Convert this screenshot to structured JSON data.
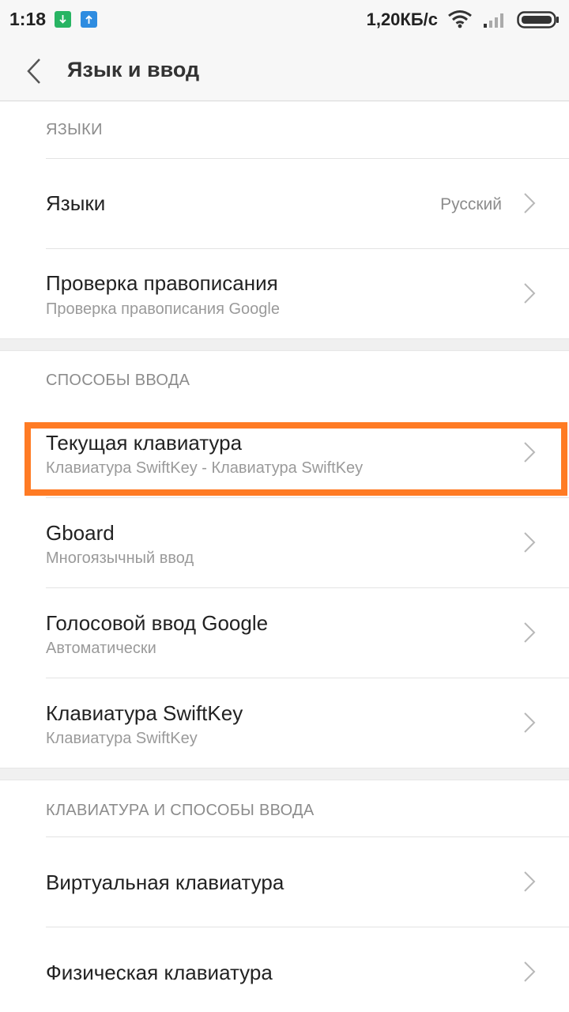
{
  "status_bar": {
    "time": "1:18",
    "speed": "1,20КБ/с",
    "notif_colors": [
      "#28b463",
      "#2e8ce0"
    ]
  },
  "header": {
    "title": "Язык и ввод",
    "back_icon": "chevron-left-icon"
  },
  "sections": [
    {
      "header": "ЯЗЫКИ",
      "items": [
        {
          "title": "Языки",
          "value": "Русский"
        },
        {
          "title": "Проверка правописания",
          "subtitle": "Проверка правописания Google"
        }
      ]
    },
    {
      "header": "СПОСОБЫ ВВОДА",
      "items": [
        {
          "title": "Текущая клавиатура",
          "subtitle": "Клавиатура SwiftKey - Клавиатура SwiftKey",
          "highlighted": true
        },
        {
          "title": "Gboard",
          "subtitle": "Многоязычный ввод"
        },
        {
          "title": "Голосовой ввод Google",
          "subtitle": "Автоматически"
        },
        {
          "title": "Клавиатура SwiftKey",
          "subtitle": "Клавиатура SwiftKey"
        }
      ]
    },
    {
      "header": "КЛАВИАТУРА И СПОСОБЫ ВВОДА",
      "items": [
        {
          "title": "Виртуальная клавиатура"
        },
        {
          "title": "Физическая клавиатура"
        }
      ]
    }
  ],
  "colors": {
    "highlight": "#ff7b24",
    "background": "#f7f7f7"
  }
}
